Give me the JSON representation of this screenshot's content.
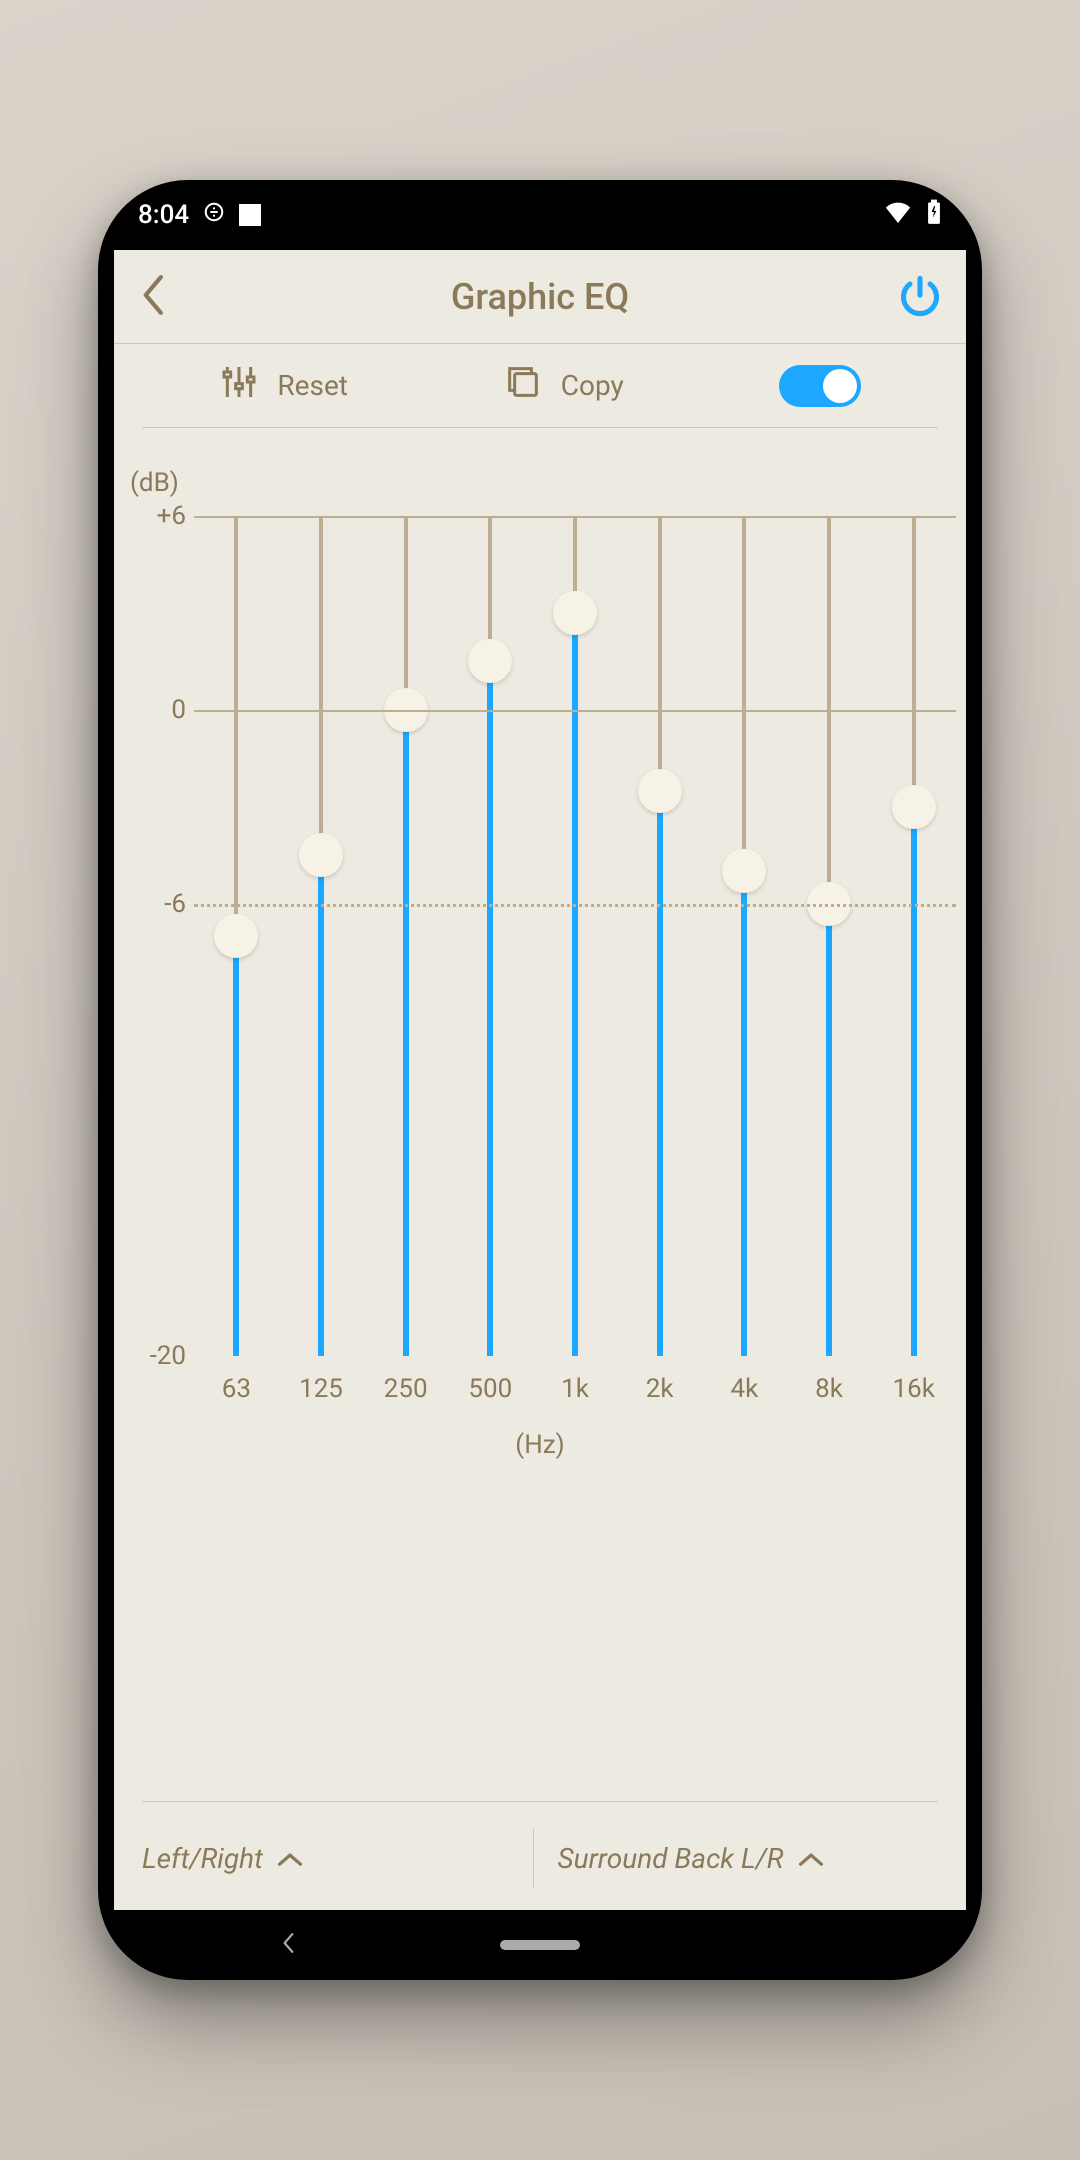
{
  "status": {
    "time": "8:04"
  },
  "header": {
    "title": "Graphic EQ"
  },
  "toolbar": {
    "reset": "Reset",
    "copy": "Copy",
    "enabled": true
  },
  "footer": {
    "left": "Left/Right",
    "right": "Surround Back L/R"
  },
  "chart_data": {
    "type": "bar",
    "title": "Graphic EQ",
    "xlabel": "(Hz)",
    "ylabel": "(dB)",
    "ylim": [
      -20,
      6
    ],
    "yticks": [
      6,
      0,
      -6,
      -20
    ],
    "ytick_labels": [
      "+6",
      "0",
      "-6",
      "-20"
    ],
    "dashed_gridline_at": -6,
    "categories": [
      "63",
      "125",
      "250",
      "500",
      "1k",
      "2k",
      "4k",
      "8k",
      "16k"
    ],
    "values": [
      -7.0,
      -4.5,
      0.0,
      1.5,
      3.0,
      -2.5,
      -5.0,
      -6.0,
      -3.0
    ]
  }
}
